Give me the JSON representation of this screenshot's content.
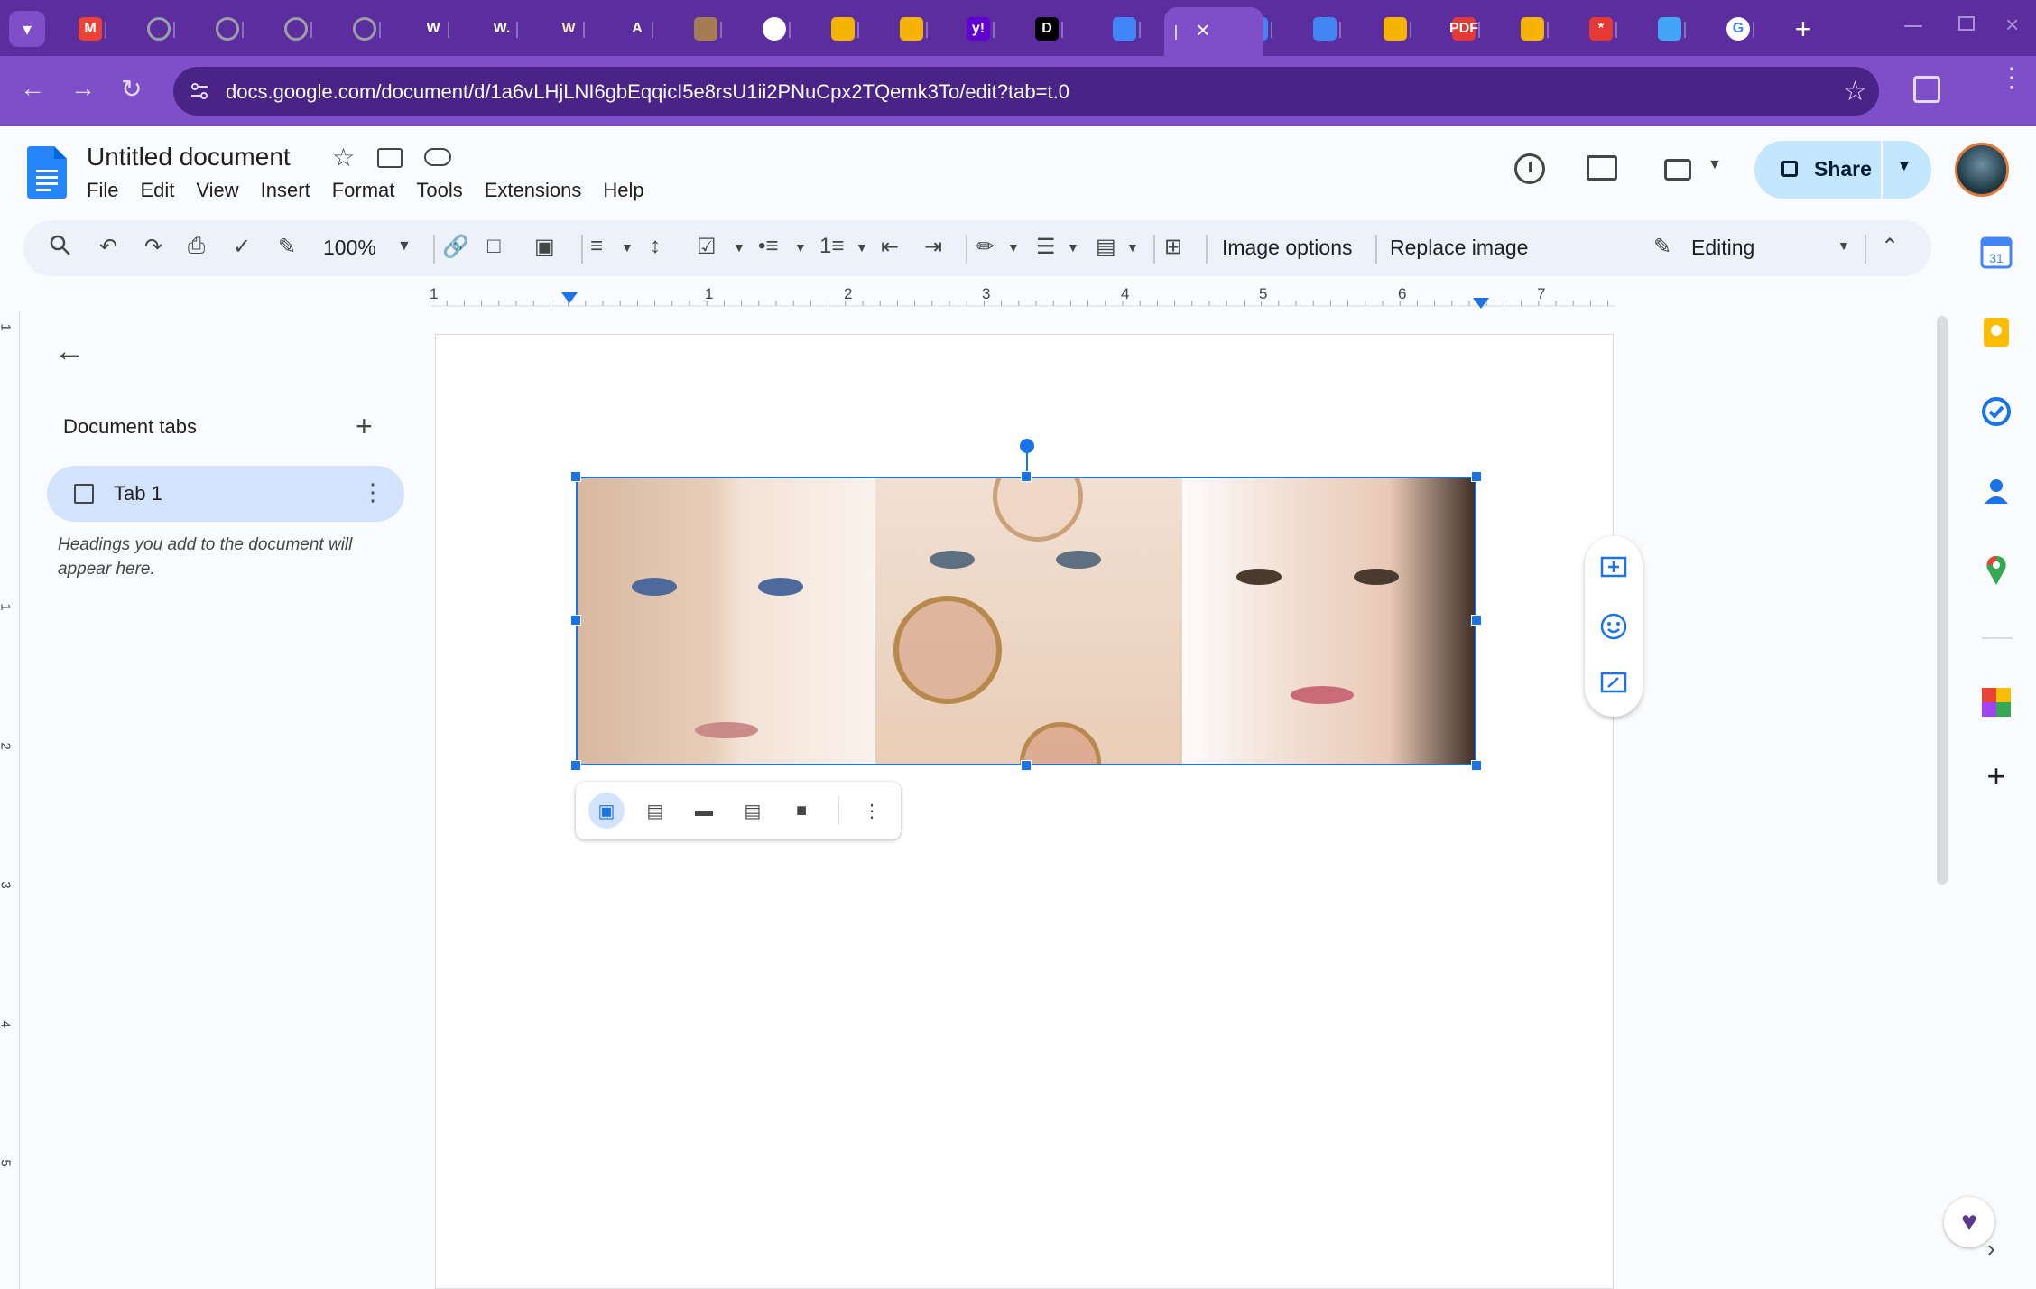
{
  "browser": {
    "url": "docs.google.com/document/d/1a6vLHjLNI6gbEqqicI5e8rsU1ii2PNuCpx2TQemk3To/edit?tab=t.0",
    "tabs": [
      {
        "icon": "gmail-icon",
        "letter": "M",
        "color": "#ea4335"
      },
      {
        "icon": "globe-icon",
        "letter": "",
        "color": "#9aa0a6"
      },
      {
        "icon": "globe-icon",
        "letter": "",
        "color": "#9aa0a6"
      },
      {
        "icon": "globe-icon",
        "letter": "",
        "color": "#9aa0a6"
      },
      {
        "icon": "globe-icon",
        "letter": "",
        "color": "#9aa0a6"
      },
      {
        "icon": "wikipedia-icon",
        "letter": "W",
        "color": "#ffffff"
      },
      {
        "icon": "wikipedia-icon",
        "letter": "W.",
        "color": "#ffffff"
      },
      {
        "icon": "crown-icon",
        "letter": "W",
        "color": "#f6e7c1"
      },
      {
        "icon": "font-icon",
        "letter": "A",
        "color": "#ffffff"
      },
      {
        "icon": "cartoon-icon",
        "letter": "",
        "color": "#a67c52"
      },
      {
        "icon": "chrome-icon",
        "letter": "",
        "color": "#ffffff"
      },
      {
        "icon": "colorful-icon",
        "letter": "",
        "color": "#f4b400"
      },
      {
        "icon": "colorful-icon",
        "letter": "",
        "color": "#f4b400"
      },
      {
        "icon": "yahoo-icon",
        "letter": "y!",
        "color": "#6001d2"
      },
      {
        "icon": "video-icon",
        "letter": "D",
        "color": "#000000"
      },
      {
        "icon": "docs-icon",
        "letter": "",
        "color": "#4285f4"
      },
      {
        "icon": "docs-icon",
        "letter": "",
        "color": "#4285f4"
      },
      {
        "icon": "docs-icon",
        "letter": "",
        "color": "#4285f4"
      },
      {
        "icon": "slides-icon",
        "letter": "",
        "color": "#f4b400"
      },
      {
        "icon": "pdf-icon",
        "letter": "PDF",
        "color": "#e53935"
      },
      {
        "icon": "slides-icon",
        "letter": "",
        "color": "#f4b400"
      },
      {
        "icon": "asterisk-icon",
        "letter": "*",
        "color": "#e53935"
      },
      {
        "icon": "edge-icon",
        "letter": "",
        "color": "#42a5f5"
      },
      {
        "icon": "google-icon",
        "letter": "G",
        "color": "#ffffff"
      }
    ]
  },
  "doc": {
    "title": "Untitled document",
    "menus": [
      "File",
      "Edit",
      "View",
      "Insert",
      "Format",
      "Tools",
      "Extensions",
      "Help"
    ],
    "share_label": "Share"
  },
  "toolbar": {
    "zoom": "100%",
    "image_options": "Image options",
    "replace_image": "Replace image",
    "mode": "Editing"
  },
  "ruler": {
    "numbers": [
      "1",
      "1",
      "2",
      "3",
      "4",
      "5",
      "6",
      "7"
    ],
    "left_numbers": [
      "1",
      "1",
      "2",
      "3",
      "4",
      "5"
    ]
  },
  "sidebar": {
    "heading": "Document tabs",
    "tab_label": "Tab 1",
    "hint": "Headings you add to the document will appear here."
  },
  "colors": {
    "accent": "#1a73e8",
    "share_bg": "#c2e7ff",
    "chrome": "#5b2d9e",
    "tab_selected": "#d3e3fd"
  }
}
